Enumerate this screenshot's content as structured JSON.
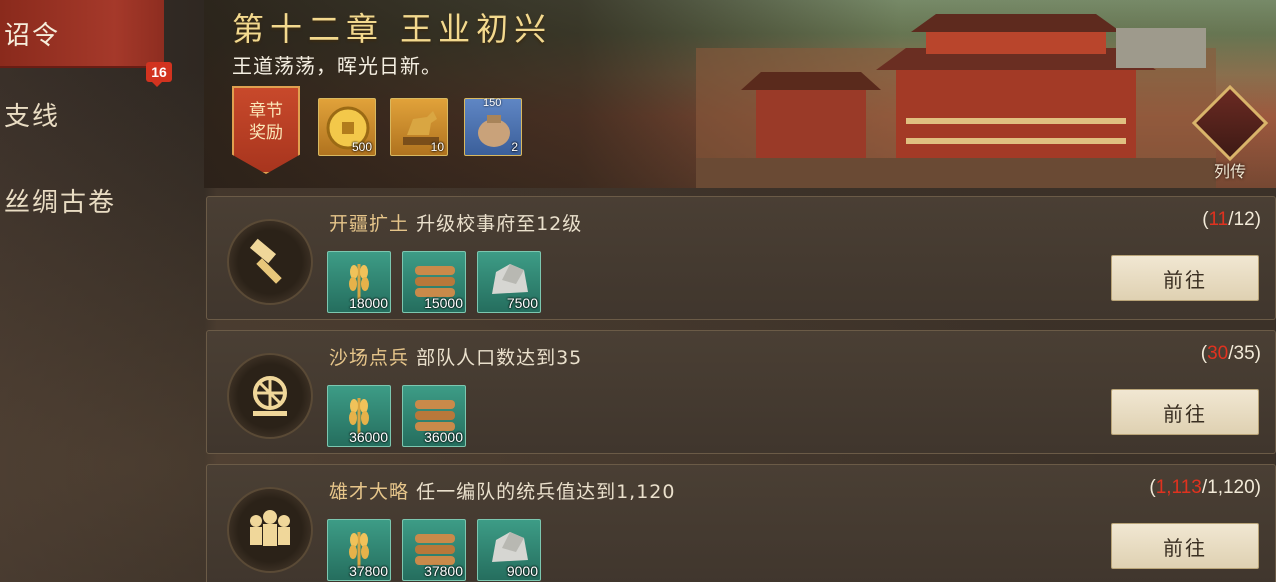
{
  "sidebar": {
    "items": [
      {
        "label": "诏令",
        "active": true,
        "badge": "16"
      },
      {
        "label": "支线",
        "active": false
      },
      {
        "label": "丝绸古卷",
        "active": false
      }
    ]
  },
  "banner": {
    "chapter_title": "第十二章 王业初兴",
    "subtitle": "王道荡荡，晖光日新。",
    "reward_tag": [
      "章节",
      "奖励"
    ],
    "rewards": [
      {
        "icon": "gold-coin-icon",
        "qty": "500"
      },
      {
        "icon": "bronze-horse-icon",
        "qty": "10"
      },
      {
        "icon": "sack-icon",
        "qty": "2",
        "top_qty": "150"
      }
    ],
    "biography_label": "列传"
  },
  "tasks": [
    {
      "icon": "hammer-icon",
      "name": "开疆扩土",
      "desc": "升级校事府至12级",
      "progress_current": "11",
      "progress_total": "12",
      "progress_open": "(",
      "progress_sep": "/",
      "progress_close": ")",
      "rewards": [
        {
          "icon": "wheat-icon",
          "qty": "18000"
        },
        {
          "icon": "wood-icon",
          "qty": "15000"
        },
        {
          "icon": "stone-icon",
          "qty": "7500"
        }
      ],
      "button": "前往"
    },
    {
      "icon": "wheel-icon",
      "name": "沙场点兵",
      "desc": "部队人口数达到35",
      "progress_current": "30",
      "progress_total": "35",
      "progress_open": "(",
      "progress_sep": "/",
      "progress_close": ")",
      "rewards": [
        {
          "icon": "wheat-icon",
          "qty": "36000"
        },
        {
          "icon": "wood-icon",
          "qty": "36000"
        }
      ],
      "button": "前往"
    },
    {
      "icon": "soldiers-icon",
      "name": "雄才大略",
      "desc": "任一编队的统兵值达到1,120",
      "progress_current": "1,113",
      "progress_total": "1,120",
      "progress_open": "(",
      "progress_sep": "/",
      "progress_close": ")",
      "rewards": [
        {
          "icon": "wheat-icon",
          "qty": "37800"
        },
        {
          "icon": "wood-icon",
          "qty": "37800"
        },
        {
          "icon": "stone-icon",
          "qty": "9000"
        }
      ],
      "button": "前往"
    }
  ]
}
